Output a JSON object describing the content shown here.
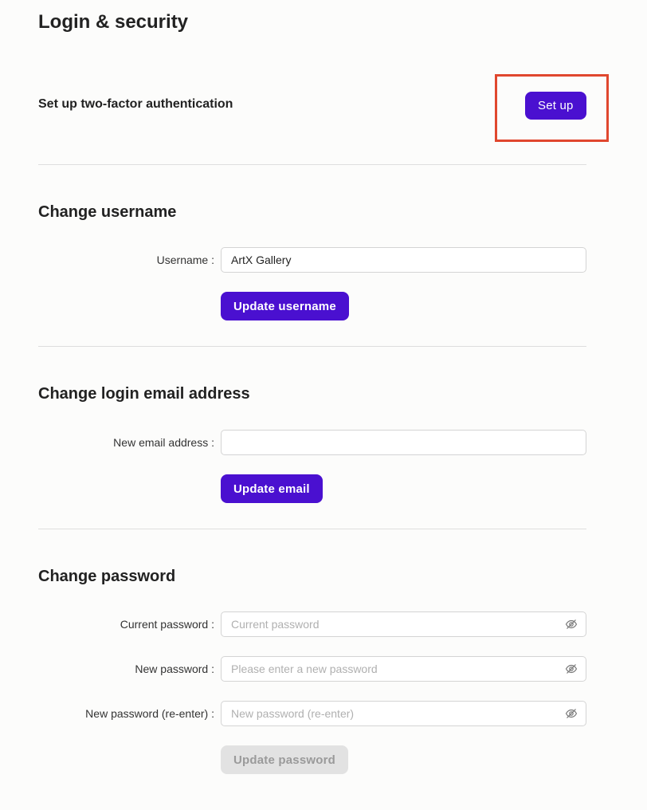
{
  "page": {
    "title": "Login & security"
  },
  "two_factor": {
    "label": "Set up two-factor authentication",
    "button_label": "Set up"
  },
  "username_section": {
    "title": "Change username",
    "field_label": "Username :",
    "value": "ArtX Gallery",
    "button_label": "Update username"
  },
  "email_section": {
    "title": "Change login email address",
    "field_label": "New email address :",
    "value": "",
    "button_label": "Update email"
  },
  "password_section": {
    "title": "Change password",
    "current": {
      "label": "Current password :",
      "placeholder": "Current password",
      "icon": "eye-off-icon"
    },
    "new": {
      "label": "New password :",
      "placeholder": "Please enter a new password",
      "icon": "eye-off-icon"
    },
    "reenter": {
      "label": "New password (re-enter) :",
      "placeholder": "New password (re-enter)",
      "icon": "eye-off-icon"
    },
    "button_label": "Update password",
    "button_disabled": true
  },
  "colors": {
    "accent": "#4a10d0",
    "highlight": "#e0472e",
    "disabled_bg": "#e2e2e2",
    "background": "#fcfcfb"
  }
}
